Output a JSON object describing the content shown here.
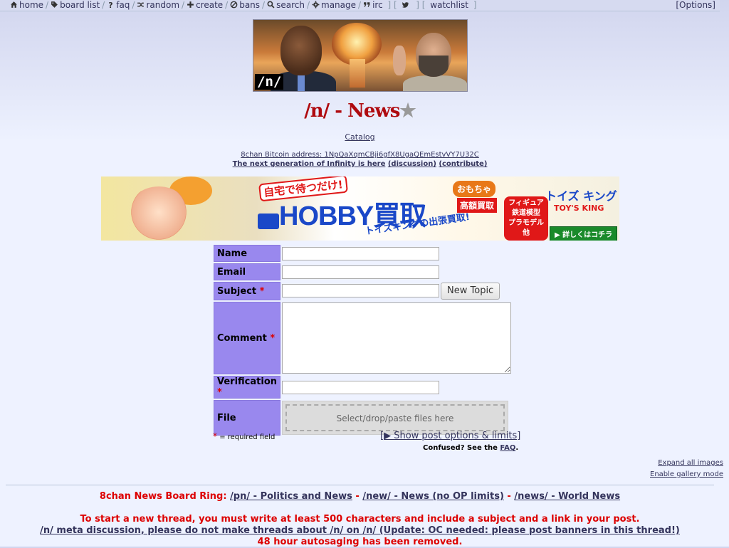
{
  "nav": {
    "items": [
      {
        "icon": "home-icon",
        "label": "home"
      },
      {
        "icon": "tag-icon",
        "label": "board list"
      },
      {
        "icon": "question-icon",
        "label": "faq"
      },
      {
        "icon": "shuffle-icon",
        "label": "random"
      },
      {
        "icon": "plus-icon",
        "label": "create"
      },
      {
        "icon": "ban-icon",
        "label": "bans"
      },
      {
        "icon": "search-icon",
        "label": "search"
      },
      {
        "icon": "gear-icon",
        "label": "manage"
      },
      {
        "icon": "quote-icon",
        "label": "irc"
      }
    ],
    "twitter_icon": "twitter-icon",
    "watchlist": "watchlist",
    "options": "[Options]"
  },
  "banner": {
    "tag": "/n/"
  },
  "board": {
    "title": "/n/ - News",
    "star": "★"
  },
  "links": {
    "catalog": "Catalog",
    "bitcoin": "8chan Bitcoin address: 1NpQaXqmCBji6gfX8UgaQEmEstvVY7U32C",
    "nextgen": "The next generation of Infinity is here",
    "discussion": "(discussion)",
    "contribute": "(contribute)"
  },
  "ad": {
    "line1": "自宅で待つだけ!",
    "line2": "HOBBY買取",
    "line3": "トイズキングの出張買取!",
    "badge1": "おもちゃ",
    "badge2": "高額買取",
    "badge3": "フィギュア 鉄道模型 プラモデル他",
    "brand": "トイズ キング",
    "brand_en": "TOY'S KING",
    "cta": "▶ 詳しくはコチラ"
  },
  "form": {
    "name_label": "Name",
    "email_label": "Email",
    "subject_label": "Subject",
    "comment_label": "Comment",
    "verification_label": "Verification",
    "file_label": "File",
    "required_mark": "*",
    "submit": "New Topic",
    "dropzone": "Select/drop/paste files here",
    "required_note": "= required field",
    "show_options": "[▶ Show post options & limits]",
    "confused": "Confused? See the",
    "faq_link": "FAQ",
    "period": "."
  },
  "thread_tools": {
    "expand": "Expand all images",
    "gallery": "Enable gallery mode"
  },
  "ring": {
    "prefix": "8chan News Board Ring:",
    "b1": "/pn/ - Politics and News",
    "dash": " - ",
    "b2": "/new/ - News (no OP limits)",
    "b3": "/news/ - World News"
  },
  "rules": {
    "r1": "To start a new thread, you must write at least 500 characters and include a subject and a link in your post.",
    "r2": "/n/ meta discussion, please do not make threads about /n/ on /n/ (Update: OC needed: please post banners in this thread!)",
    "r3": "48 hour autosaging has been removed."
  }
}
